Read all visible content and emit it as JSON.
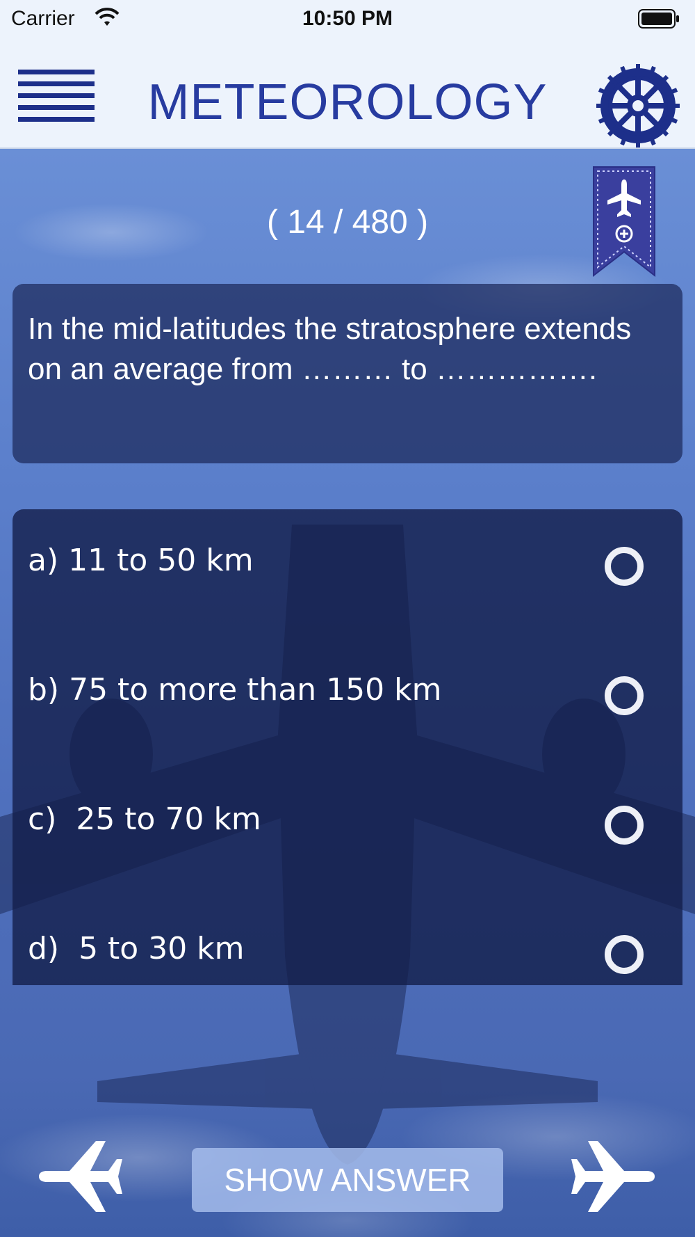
{
  "status_bar": {
    "carrier": "Carrier",
    "time": "10:50 PM"
  },
  "header": {
    "title": "METEOROLOGY",
    "title_color": "#273ba0",
    "menu_icon": "hamburger-menu-icon",
    "settings_icon": "gear-icon"
  },
  "quiz": {
    "counter": "( 14 / 480 )",
    "question": "In the mid-latitudes the stratosphere extends on an average from ……… to …………….",
    "answers": [
      {
        "label": "a) 11 to 50 km"
      },
      {
        "label": "b) 75 to more than 150 km"
      },
      {
        "label": "c)  25 to 70 km"
      },
      {
        "label": "d)  5 to 30 km"
      }
    ],
    "bookmark_icon": "bookmark-add-icon"
  },
  "footer": {
    "show_answer_label": "SHOW ANSWER",
    "prev_icon": "airplane-left-icon",
    "next_icon": "airplane-right-icon"
  }
}
